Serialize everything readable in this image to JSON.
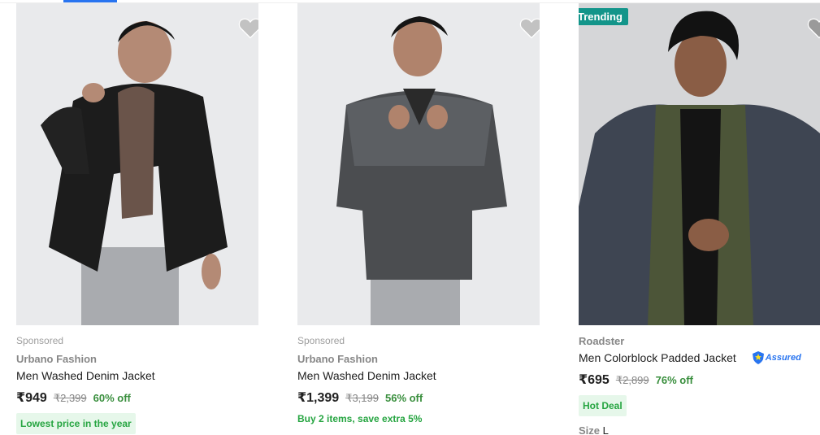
{
  "products": [
    {
      "sponsored": "Sponsored",
      "brand": "Urbano Fashion",
      "title": "Men Washed Denim Jacket",
      "price": "₹949",
      "mrp": "₹2,399",
      "discount": "60% off",
      "offer": "Lowest price in the year",
      "wishlist_icon": "heart-icon"
    },
    {
      "sponsored": "Sponsored",
      "brand": "Urbano Fashion",
      "title": "Men Washed Denim Jacket",
      "price": "₹1,399",
      "mrp": "₹3,199",
      "discount": "56% off",
      "offer": "Buy 2 items, save extra 5%",
      "wishlist_icon": "heart-icon"
    },
    {
      "badge": "Trending",
      "brand": "Roadster",
      "title": "Men Colorblock Padded Jacket",
      "assured": "Assured",
      "price": "₹695",
      "mrp": "₹2,899",
      "discount": "76% off",
      "offer": "Hot Deal",
      "size_label": "Size",
      "size_value": "L",
      "wishlist_icon": "heart-icon"
    }
  ],
  "colors": {
    "accent": "#2874f0",
    "discount_green": "#388e3c",
    "offer_green": "#26a541",
    "trending_badge": "#13958a"
  }
}
